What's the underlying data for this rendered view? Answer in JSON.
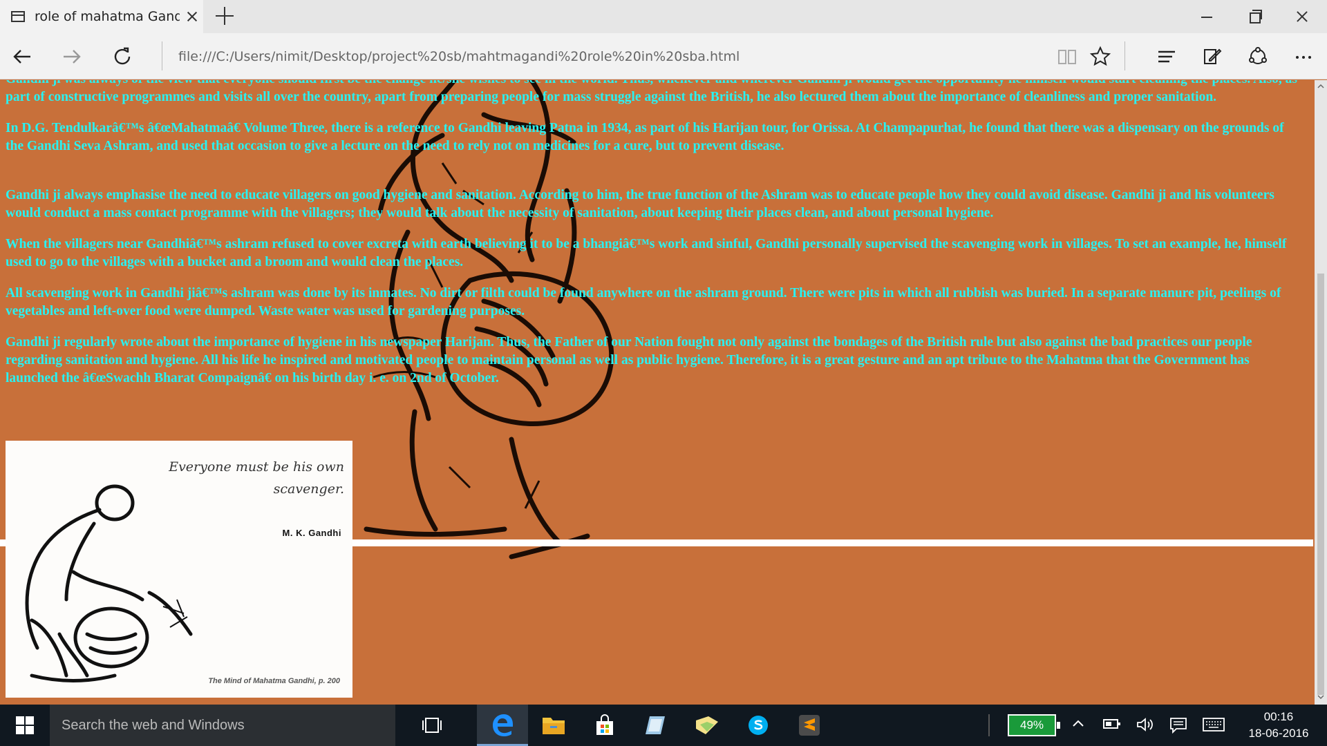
{
  "browser": {
    "tab_title": "role of mahatma Gandh",
    "address": "file:///C:/Users/nimit/Desktop/project%20sb/mahtmagandi%20role%20in%20sba.html"
  },
  "page": {
    "paragraphs": [
      "Gandhi ji was always of the view that everyone should first be the change he/she wishes to see in the world. Thus, whenever and wherever Gandhi ji would get the opportunity he himself would start cleaning the places. Also, as part of constructive programmes and visits all over the country, apart from preparing people for mass struggle against the British, he also lectured them about the importance of cleanliness and proper sanitation.",
      "In D.G. Tendulkarâ€™s â€œMahatmaâ€ Volume Three, there is a reference to Gandhi leaving Patna in 1934, as part of his Harijan tour, for Orissa. At Champapurhat, he found that there was a dispensary on the grounds of the Gandhi Seva Ashram, and used that occasion to give a lecture on the need to rely not on medicines for a cure, but to prevent disease.",
      "Gandhi ji always emphasise the need to educate villagers on good hygiene and sanitation. According to him, the true function of the Ashram was to educate people how they could avoid disease. Gandhi ji and his volunteers would conduct a mass contact programme with the villagers; they would talk about the necessity of sanitation, about keeping their places clean, and about personal hygiene.",
      "When the villagers near Gandhiâ€™s ashram refused to cover excreta with earth believing it to be a bhangiâ€™s work and sinful, Gandhi personally supervised the scavenging work in villages. To set an example, he, himself used to go to the villages with a bucket and a broom and would clean the places.",
      "All scavenging work in Gandhi jiâ€™s ashram was done by its inmates. No dirt or filth could be found anywhere on the ashram ground. There were pits in which all rubbish was buried. In a separate manure pit, peelings of vegetables and left-over food were dumped. Waste water was used for gardening purposes.",
      "Gandhi ji regularly wrote about the importance of hygiene in his newspaper Harijan. Thus, the Father of our Nation fought not only against the bondages of the British rule but also against the bad practices our people regarding sanitation and hygiene. All his life he inspired and motivated people to maintain personal as well as public hygiene. Therefore, it is a great gesture and an apt tribute to the Mahatma that the Government has launched the â€œSwachh Bharat Compaignâ€ on his birth day i. e. on 2nd of October."
    ],
    "quote": {
      "text": "Everyone must be his own scavenger.",
      "author": "M. K. Gandhi",
      "source": "The Mind of Mahatma Gandhi, p. 200"
    }
  },
  "taskbar": {
    "search_placeholder": "Search the web and Windows",
    "battery": "49%",
    "time": "00:16",
    "date": "18-06-2016"
  },
  "colors": {
    "page_bg": "#c8703a",
    "text": "#29f2f2",
    "taskbar_bg": "#101820"
  }
}
